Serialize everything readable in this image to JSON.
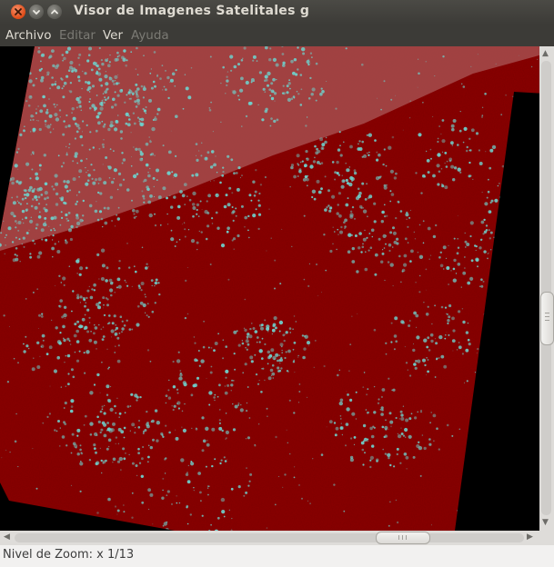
{
  "window": {
    "title": "Visor de Imagenes Satelitales g",
    "controls": [
      "close-icon",
      "minimize-icon",
      "maximize-icon"
    ]
  },
  "menu": {
    "items": [
      {
        "label": "Archivo",
        "enabled": true
      },
      {
        "label": "Editar",
        "enabled": false
      },
      {
        "label": "Ver",
        "enabled": true
      },
      {
        "label": "Ayuda",
        "enabled": false
      }
    ]
  },
  "image": {
    "kind": "satellite scene, false-color",
    "colors": {
      "background": "#000000",
      "scene": "#7d0000",
      "haze_band": "#a64c4c",
      "vegetation_speckle": "#6ed2cd"
    }
  },
  "status": {
    "zoom_label": "Nivel de Zoom: x 1/13"
  },
  "scroll": {
    "vertical_position": 0.52,
    "horizontal_position": 0.74
  }
}
